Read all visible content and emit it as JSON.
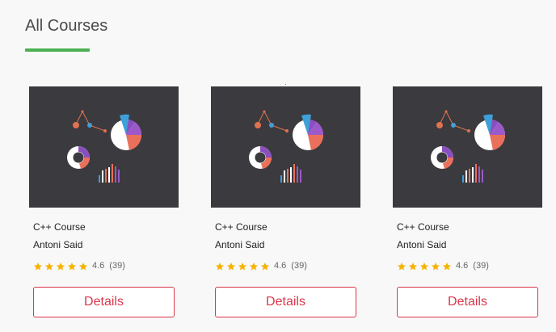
{
  "section": {
    "title": "All Courses",
    "accent_color": "#4caf50"
  },
  "courses": [
    {
      "name": "C++ Course",
      "author": "Antoni Said",
      "rating": "4.6",
      "reviews": "(39)",
      "stars": 5,
      "button_label": "Details"
    },
    {
      "name": "C++ Course",
      "author": "Antoni Said",
      "rating": "4.6",
      "reviews": "(39)",
      "stars": 5,
      "button_label": "Details"
    },
    {
      "name": "C++ Course",
      "author": "Antoni Said",
      "rating": "4.6",
      "reviews": "(39)",
      "stars": 5,
      "button_label": "Details"
    }
  ],
  "colors": {
    "button": "#d9364a",
    "star": "#f5b301",
    "thumbnail_bg": "#3b3a3e"
  }
}
